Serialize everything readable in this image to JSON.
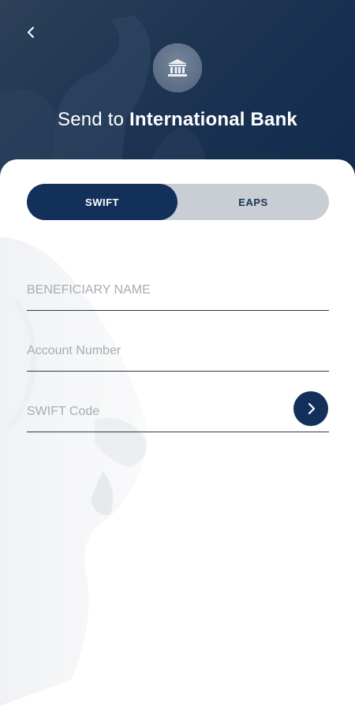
{
  "header": {
    "title_prefix": "Send to",
    "title_emphasis": "International Bank",
    "back_icon": "chevron-left-icon",
    "bank_icon": "bank-icon"
  },
  "tabs": [
    {
      "label": "SWIFT",
      "active": true
    },
    {
      "label": "EAPS",
      "active": false
    }
  ],
  "form": {
    "beneficiary_name_placeholder": "BENEFICIARY NAME",
    "account_number_placeholder": "Account Number",
    "swift_code_placeholder": "SWIFT Code",
    "submit_icon": "chevron-right-icon"
  },
  "colors": {
    "primary": "#13305a",
    "header_bg": "#1d3452",
    "tab_inactive_bg": "#c9ced4",
    "placeholder": "#a6adb6"
  }
}
